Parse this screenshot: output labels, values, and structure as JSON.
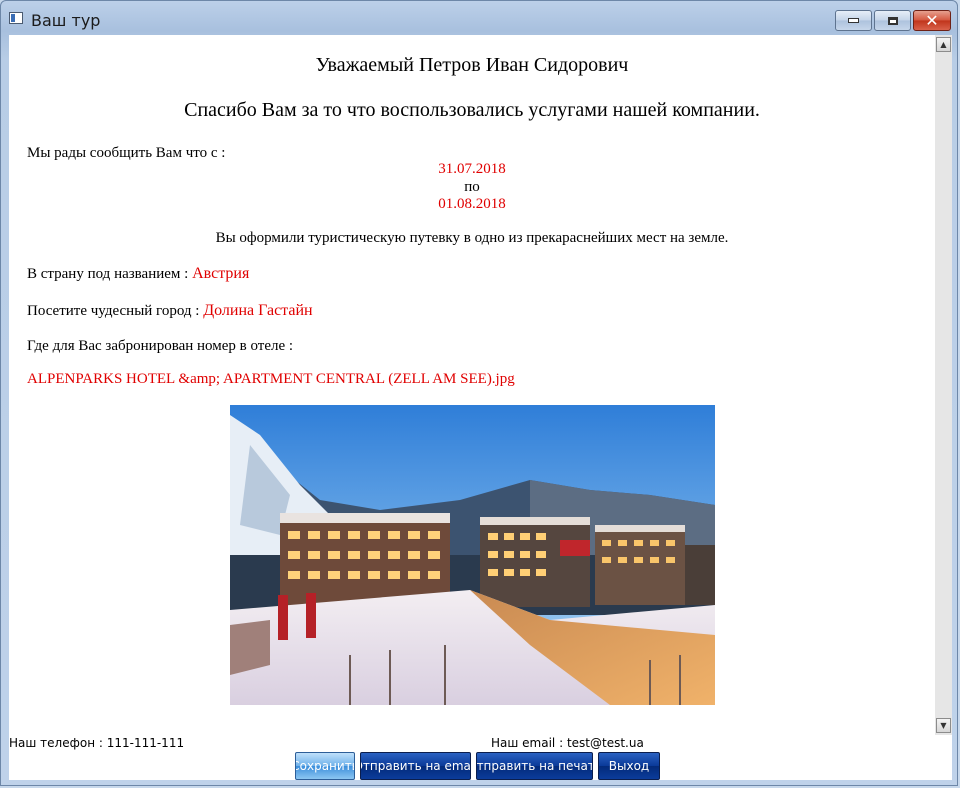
{
  "window": {
    "title": "Ваш тур"
  },
  "letter": {
    "greeting": "Уважаемый Петров Иван Сидорович",
    "thanks": "Спасибо Вам за то что воспользовались услугами нашей компании.",
    "glad_text": "Мы рады сообщить Вам что с :",
    "date_from": "31.07.2018",
    "date_sep": "по",
    "date_to": "01.08.2018",
    "booked_text": "Вы оформили туристическую путевку в одно из прекараснейших мест на земле.",
    "country_label": "В страну под названием : ",
    "country": "Австрия",
    "city_label": "Посетите чудесный город : ",
    "city": "Долина Гастайн",
    "hotel_label": "Где для Вас забронирован номер в отеле :",
    "hotel_file": "ALPENPARKS HOTEL &amp; APARTMENT CENTRAL (ZELL AM SEE).jpg"
  },
  "footer": {
    "phone": "Наш телефон : 111-111-111",
    "email": "Наш email : test@test.ua"
  },
  "buttons": {
    "save": "Сохранить",
    "send_email": "Отправить на email",
    "send_print": "Отправить на печать",
    "exit": "Выход"
  },
  "colors": {
    "highlight": "#e00000",
    "button_blue": "#0a3998",
    "button_active": "#6fb1ea"
  }
}
